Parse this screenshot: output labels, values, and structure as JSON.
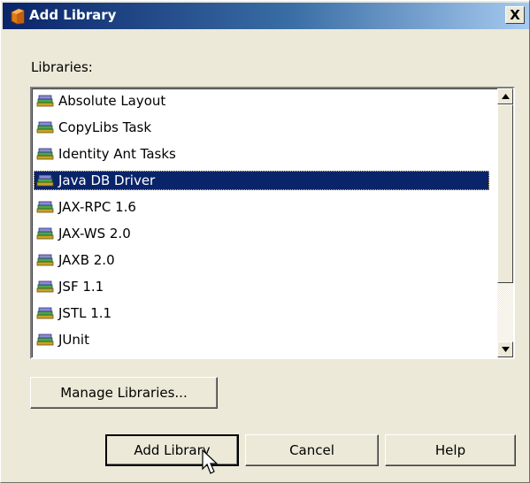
{
  "window": {
    "title": "Add Library",
    "close_label": "X"
  },
  "libraries_label": "Libraries:",
  "libraries": [
    {
      "label": "Absolute Layout",
      "selected": false
    },
    {
      "label": "CopyLibs Task",
      "selected": false
    },
    {
      "label": "Identity Ant Tasks",
      "selected": false
    },
    {
      "label": "Java DB Driver",
      "selected": true
    },
    {
      "label": "JAX-RPC 1.6",
      "selected": false
    },
    {
      "label": "JAX-WS 2.0",
      "selected": false
    },
    {
      "label": "JAXB 2.0",
      "selected": false
    },
    {
      "label": "JSF 1.1",
      "selected": false
    },
    {
      "label": "JSTL 1.1",
      "selected": false
    },
    {
      "label": "JUnit",
      "selected": false
    }
  ],
  "buttons": {
    "manage_libraries": "Manage Libraries...",
    "add_library": "Add Library",
    "cancel": "Cancel",
    "help": "Help"
  },
  "colors": {
    "selection": "#0a246a",
    "dialog_bg": "#ece9d8"
  },
  "icons": {
    "title": "library-folder-icon",
    "item": "library-jar-icon"
  }
}
